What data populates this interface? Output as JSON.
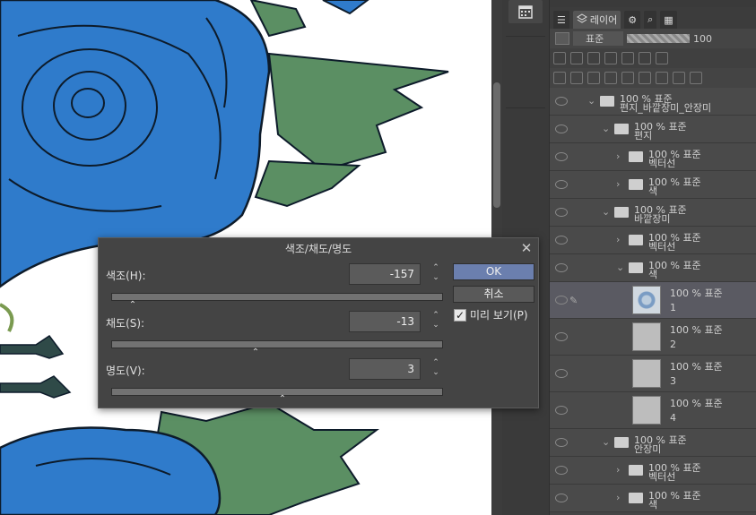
{
  "layer_panel": {
    "tab_label": "레이어",
    "blend_mode": "표준",
    "opacity": "100",
    "layers": [
      {
        "depth": 0,
        "type": "folder",
        "mode": "100 % 표준",
        "name": "편지_바깥장미_안장미"
      },
      {
        "depth": 1,
        "type": "folder",
        "mode": "100 % 표준",
        "name": "편지"
      },
      {
        "depth": 2,
        "type": "folder",
        "mode": "100 % 표준",
        "name": "벡터선"
      },
      {
        "depth": 2,
        "type": "folder",
        "mode": "100 % 표준",
        "name": "색"
      },
      {
        "depth": 1,
        "type": "folder",
        "mode": "100 % 표준",
        "name": "바깥장미"
      },
      {
        "depth": 2,
        "type": "folder",
        "mode": "100 % 표준",
        "name": "벡터선"
      },
      {
        "depth": 2,
        "type": "folder",
        "mode": "100 % 표준",
        "name": "색",
        "open": true
      },
      {
        "depth": 3,
        "type": "raster",
        "mode": "100 % 표준",
        "name": "1",
        "selected": true,
        "thumb": "blue"
      },
      {
        "depth": 3,
        "type": "raster",
        "mode": "100 % 표준",
        "name": "2"
      },
      {
        "depth": 3,
        "type": "raster",
        "mode": "100 % 표준",
        "name": "3"
      },
      {
        "depth": 3,
        "type": "raster",
        "mode": "100 % 표준",
        "name": "4"
      },
      {
        "depth": 1,
        "type": "folder",
        "mode": "100 % 표준",
        "name": "안장미"
      },
      {
        "depth": 2,
        "type": "folder",
        "mode": "100 % 표준",
        "name": "벡터선"
      },
      {
        "depth": 2,
        "type": "folder",
        "mode": "100 % 표준",
        "name": "색"
      }
    ]
  },
  "dialog": {
    "title": "색조/채도/명도",
    "close": "✕",
    "hue_label": "색조(H):",
    "hue_value": "-157",
    "saturation_label": "채도(S):",
    "saturation_value": "-13",
    "value_label": "명도(V):",
    "value_value": "3",
    "ok_label": "OK",
    "cancel_label": "취소",
    "preview_label": "미리 보기(P)",
    "preview_checked": true
  },
  "colors": {
    "rose_fill": "#2f7bcb",
    "leaf_fill": "#5b8f63",
    "stem_fill": "#2f4a48",
    "outline": "#0d1b2a"
  }
}
